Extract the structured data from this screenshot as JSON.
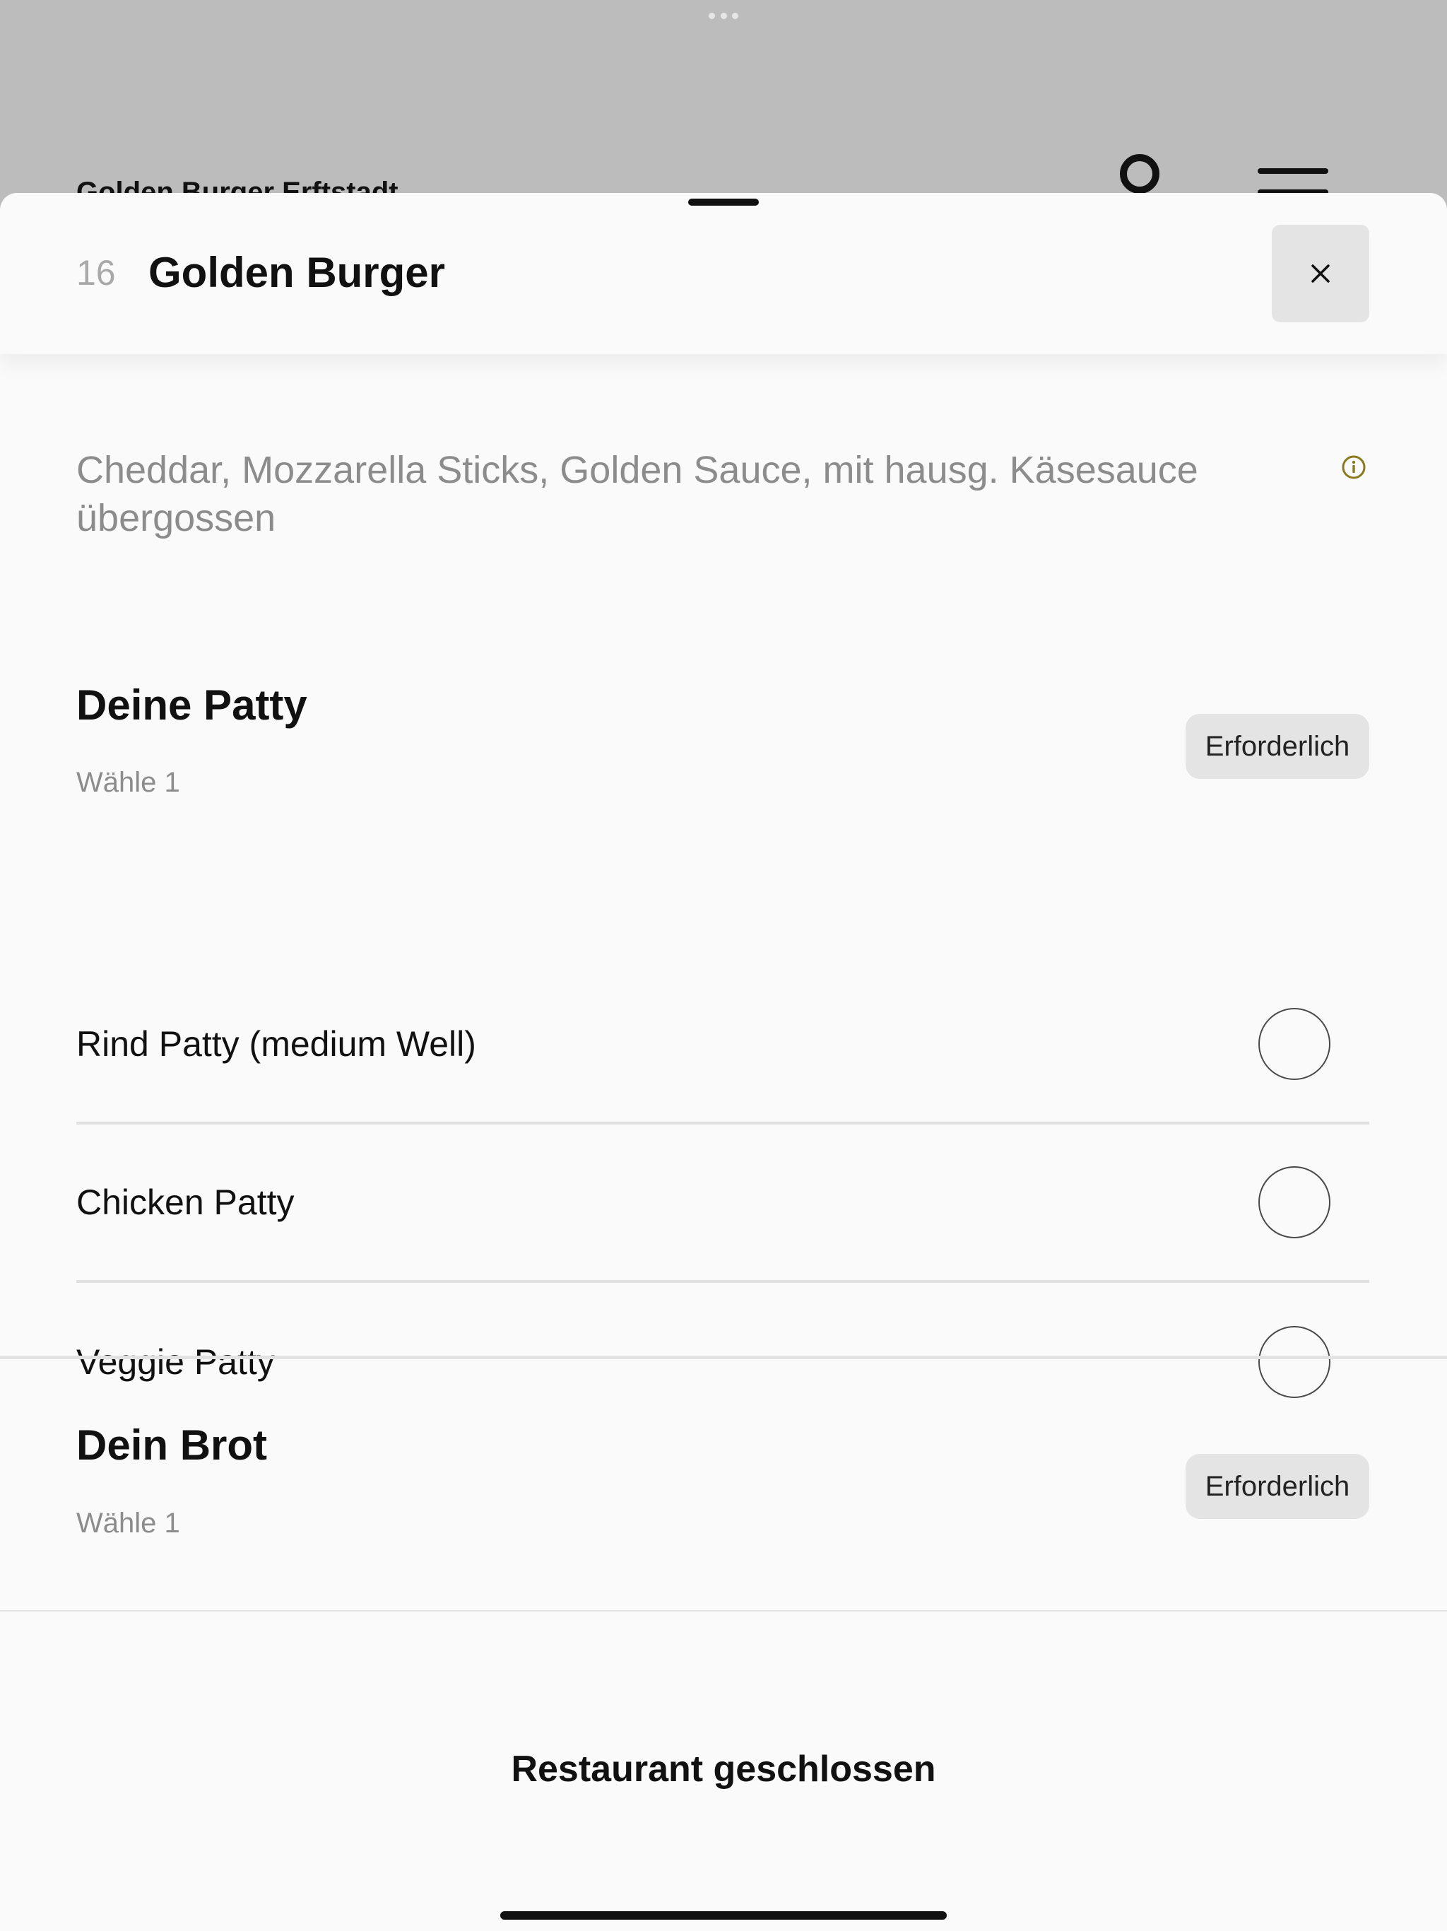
{
  "background": {
    "restaurant_title": "Golden Burger Erftstadt"
  },
  "item": {
    "number": "16",
    "title": "Golden Burger",
    "description": "Cheddar, Mozzarella Sticks, Golden Sauce, mit hausg. Käsesauce übergossen"
  },
  "sections": [
    {
      "title": "Deine Patty",
      "subtitle": "Wähle 1",
      "badge": "Erforderlich",
      "options": [
        {
          "label": "Rind Patty (medium Well)",
          "selected": false
        },
        {
          "label": "Chicken Patty",
          "selected": false
        },
        {
          "label": "Veggie Patty",
          "selected": false
        }
      ]
    },
    {
      "title": "Dein Brot",
      "subtitle": "Wähle 1",
      "badge": "Erforderlich"
    }
  ],
  "footer": {
    "status": "Restaurant geschlossen"
  },
  "colors": {
    "accent_info": "#8a7a1f",
    "badge_bg": "#e4e4e4",
    "sheet_bg": "#fafafa",
    "overlay_bg": "#bcbcbc"
  }
}
